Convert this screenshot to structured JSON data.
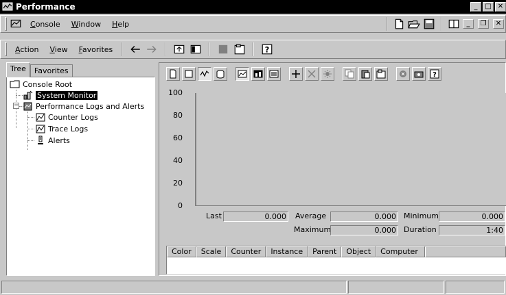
{
  "window": {
    "title": "Performance"
  },
  "menubar": {
    "items": [
      {
        "label": "Console",
        "accel": "C",
        "rest": "onsole"
      },
      {
        "label": "Window",
        "accel": "W",
        "rest": "indow"
      },
      {
        "label": "Help",
        "accel": "H",
        "rest": "elp"
      }
    ]
  },
  "action_bar": {
    "items": [
      {
        "label": "Action",
        "accel": "A",
        "rest": "ction"
      },
      {
        "label": "View",
        "accel": "V",
        "rest": "iew"
      },
      {
        "label": "Favorites",
        "accel": "F",
        "rest": "avorites"
      }
    ]
  },
  "tabs": [
    {
      "label": "Tree",
      "active": true
    },
    {
      "label": "Favorites",
      "active": false
    }
  ],
  "tree": {
    "root": "Console Root",
    "system_monitor": "System Monitor",
    "logs_alerts": "Performance Logs and Alerts",
    "counter_logs": "Counter Logs",
    "trace_logs": "Trace Logs",
    "alerts": "Alerts"
  },
  "graph": {
    "y_ticks": [
      "100",
      "80",
      "60",
      "40",
      "20",
      "0"
    ]
  },
  "stats": {
    "last_label": "Last",
    "last_value": "0.000",
    "average_label": "Average",
    "average_value": "0.000",
    "minimum_label": "Minimum",
    "minimum_value": "0.000",
    "maximum_label": "Maximum",
    "maximum_value": "0.000",
    "duration_label": "Duration",
    "duration_value": "1:40"
  },
  "counter_table": {
    "columns": [
      "Color",
      "Scale",
      "Counter",
      "Instance",
      "Parent",
      "Object",
      "Computer"
    ]
  },
  "colors": {
    "face": "#c8c8c8",
    "titlebar": "#000000",
    "selection": "#000000"
  }
}
